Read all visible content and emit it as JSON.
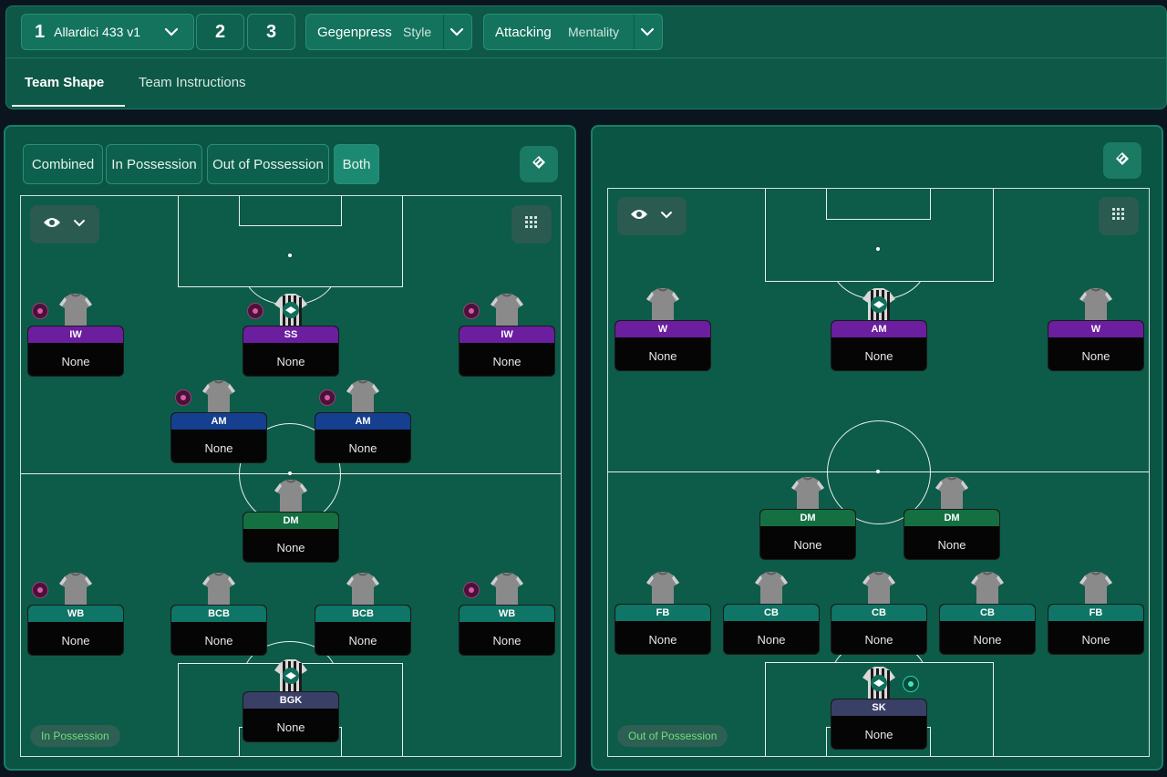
{
  "tactic_selector": {
    "slot_number": "1",
    "name": "Allardici 433 v1",
    "other_slots": [
      "2",
      "3"
    ]
  },
  "style": {
    "value": "Gegenpress",
    "label": "Style"
  },
  "mentality": {
    "value": "Attacking",
    "label": "Mentality"
  },
  "tabs": [
    "Team Shape",
    "Team Instructions"
  ],
  "phase_filters": [
    "Combined",
    "In Possession",
    "Out of Possession",
    "Both"
  ],
  "active_filter": "Both",
  "left_pitch": {
    "tag": "In Possession",
    "players": [
      {
        "role": "IW",
        "duty": "None",
        "color": "purple",
        "badge": "pink"
      },
      {
        "role": "SS",
        "duty": "None",
        "color": "purple",
        "badge": "pink",
        "keeper_kit": true
      },
      {
        "role": "IW",
        "duty": "None",
        "color": "purple",
        "badge": "pink"
      },
      {
        "role": "AM",
        "duty": "None",
        "color": "blue",
        "badge": "pink"
      },
      {
        "role": "AM",
        "duty": "None",
        "color": "blue",
        "badge": "pink"
      },
      {
        "role": "DM",
        "duty": "None",
        "color": "green"
      },
      {
        "role": "WB",
        "duty": "None",
        "color": "teal",
        "badge": "pink"
      },
      {
        "role": "BCB",
        "duty": "None",
        "color": "teal"
      },
      {
        "role": "BCB",
        "duty": "None",
        "color": "teal"
      },
      {
        "role": "WB",
        "duty": "None",
        "color": "teal",
        "badge": "pink"
      },
      {
        "role": "BGK",
        "duty": "None",
        "color": "slate",
        "keeper_kit": true
      }
    ]
  },
  "right_pitch": {
    "tag": "Out of Possession",
    "players": [
      {
        "role": "W",
        "duty": "None",
        "color": "purple"
      },
      {
        "role": "AM",
        "duty": "None",
        "color": "purple",
        "keeper_kit": true
      },
      {
        "role": "W",
        "duty": "None",
        "color": "purple"
      },
      {
        "role": "DM",
        "duty": "None",
        "color": "green"
      },
      {
        "role": "DM",
        "duty": "None",
        "color": "green"
      },
      {
        "role": "FB",
        "duty": "None",
        "color": "teal"
      },
      {
        "role": "CB",
        "duty": "None",
        "color": "teal"
      },
      {
        "role": "CB",
        "duty": "None",
        "color": "teal"
      },
      {
        "role": "CB",
        "duty": "None",
        "color": "teal"
      },
      {
        "role": "FB",
        "duty": "None",
        "color": "teal"
      },
      {
        "role": "SK",
        "duty": "None",
        "color": "slate",
        "keeper_kit": true,
        "badge": "teal"
      }
    ]
  },
  "icons": {
    "dropdown": "chevron-down-icon",
    "visibility": "eye-icon",
    "grid": "grid-icon",
    "tactics_board": "tactics-board-icon"
  }
}
